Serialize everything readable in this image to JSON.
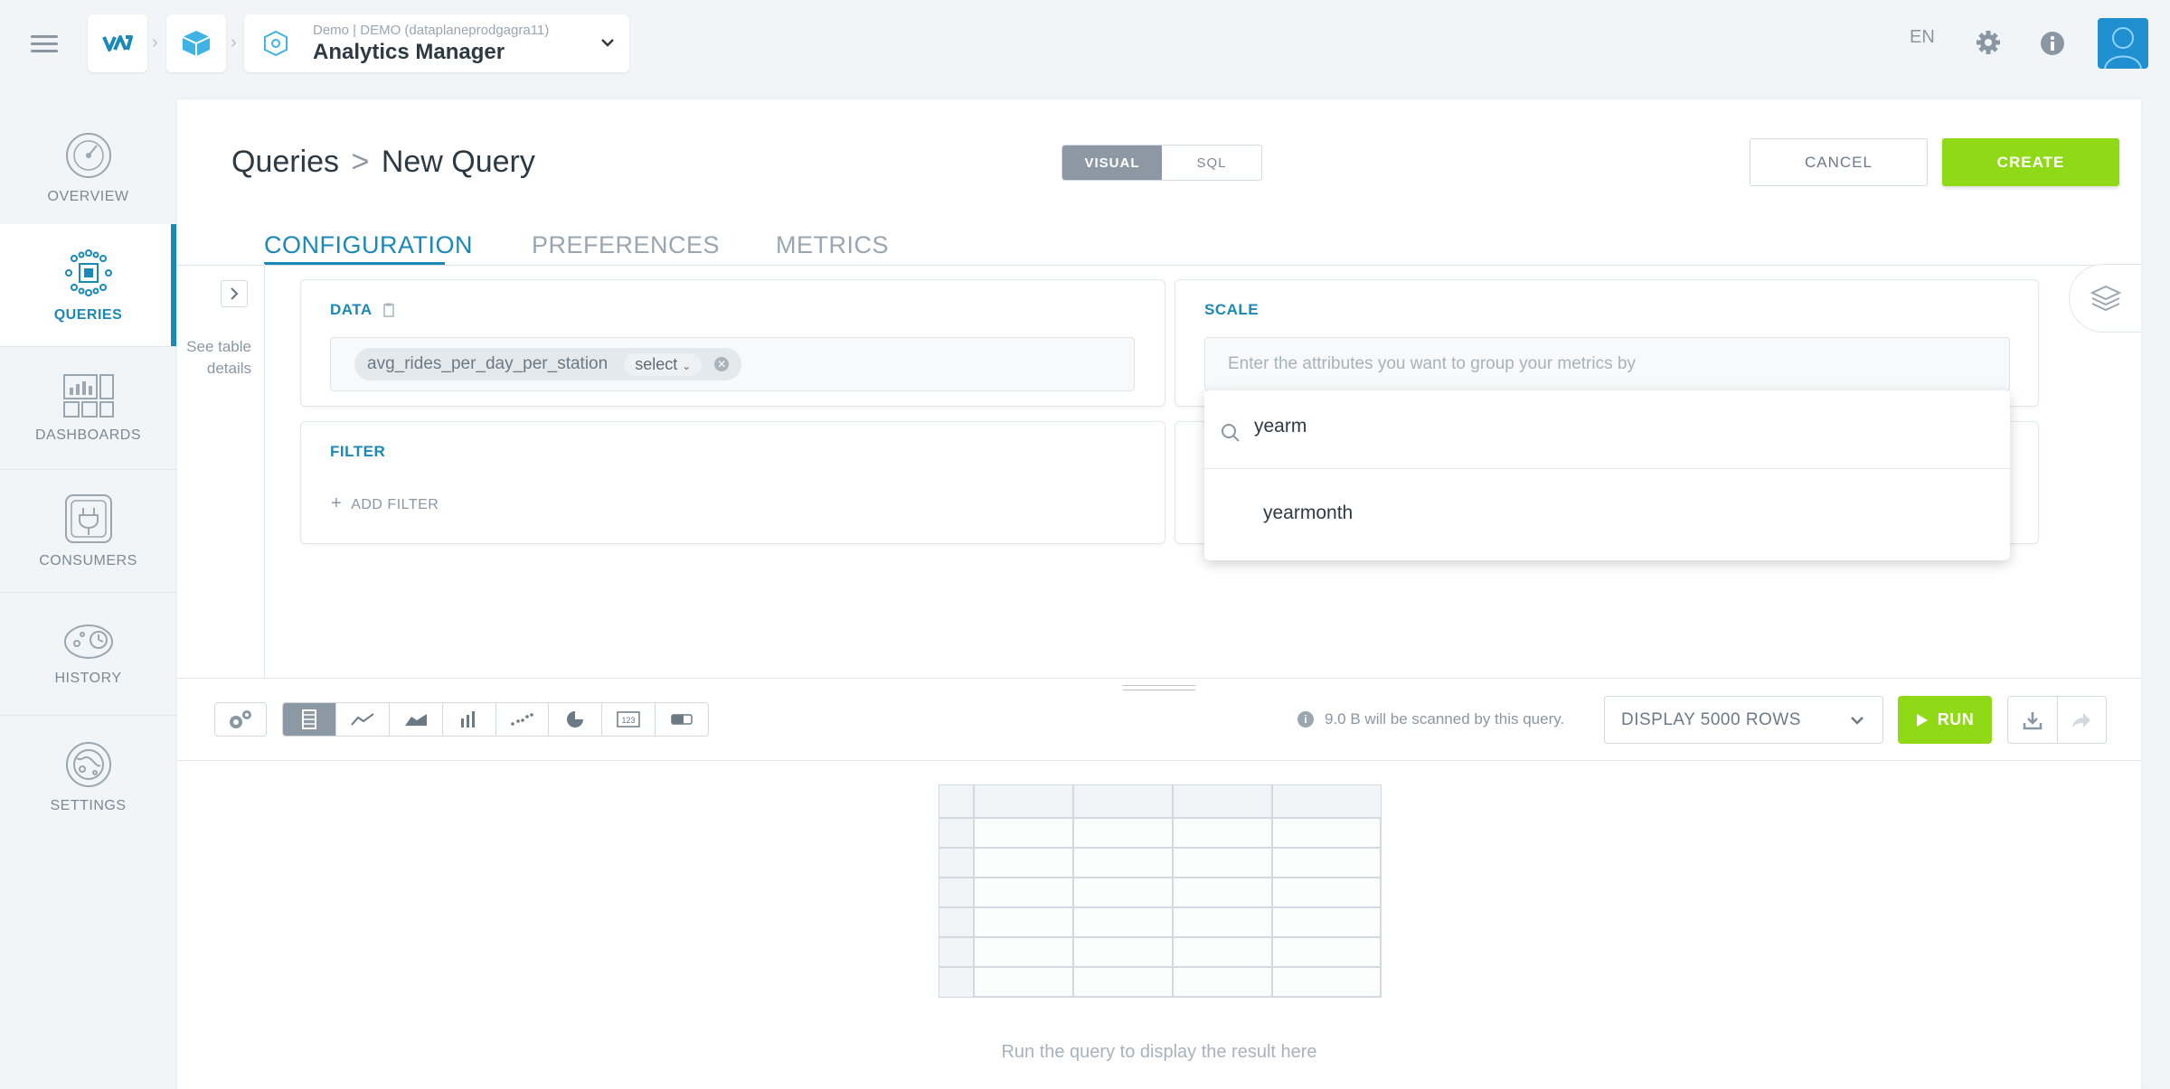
{
  "header": {
    "app_subtitle": "Demo | DEMO (dataplaneprodgagra11)",
    "app_title": "Analytics Manager",
    "language": "EN"
  },
  "nav": {
    "items": [
      {
        "label": "OVERVIEW",
        "icon": "gauge-icon"
      },
      {
        "label": "QUERIES",
        "icon": "cube-network-icon",
        "active": true
      },
      {
        "label": "DASHBOARDS",
        "icon": "dashboard-icon"
      },
      {
        "label": "CONSUMERS",
        "icon": "plug-icon"
      },
      {
        "label": "HISTORY",
        "icon": "history-icon"
      },
      {
        "label": "SETTINGS",
        "icon": "settings-globe-icon"
      }
    ]
  },
  "page": {
    "breadcrumb_root": "Queries",
    "breadcrumb_current": "New Query",
    "mode_visual": "VISUAL",
    "mode_sql": "SQL",
    "cancel_label": "CANCEL",
    "create_label": "CREATE",
    "tabs": [
      "CONFIGURATION",
      "PREFERENCES",
      "METRICS"
    ]
  },
  "config": {
    "see_table_details": "See table details",
    "data_title": "DATA",
    "data_chip_label": "avg_rides_per_day_per_station",
    "data_chip_select": "select",
    "scale_title": "SCALE",
    "scale_placeholder": "Enter the attributes you want to group your metrics by",
    "filter_title": "FILTER",
    "add_filter_label": "ADD FILTER",
    "dropdown_search_value": "yearm",
    "dropdown_option": "yearmonth"
  },
  "toolbar": {
    "scan_info": "9.0 B will be scanned by this query.",
    "display_rows": "DISPLAY 5000 ROWS",
    "run_label": "RUN"
  },
  "results": {
    "hint": "Run the query to display the result here"
  },
  "colors": {
    "accent": "#1a89b8",
    "primary_green": "#8fd916",
    "toggle_active": "#8c99a5"
  }
}
